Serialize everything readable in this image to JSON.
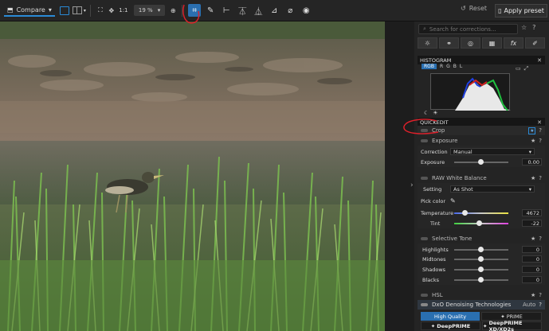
{
  "toolbar": {
    "compare_label": "Compare",
    "zoom_fit": "1:1",
    "zoom_value": "19 %",
    "reset_label": "Reset",
    "apply_preset_label": "Apply preset"
  },
  "panel": {
    "search_placeholder": "Search for corrections...",
    "histogram": {
      "title": "HISTOGRAM",
      "channels": [
        "RGB",
        "R",
        "G",
        "B",
        "L"
      ]
    },
    "quickedit": {
      "title": "QUICKEDIT",
      "crop_label": "Crop",
      "exposure": {
        "label": "Exposure",
        "correction_label": "Correction",
        "correction_value": "Manual",
        "exposure_label": "Exposure",
        "exposure_value": "0.00"
      },
      "raw_wb": {
        "label": "RAW White Balance",
        "setting_label": "Setting",
        "setting_value": "As Shot",
        "pick_color_label": "Pick color",
        "temperature_label": "Temperature",
        "temperature_value": "4672",
        "tint_label": "Tint",
        "tint_value": "-22"
      },
      "selective_tone": {
        "label": "Selective Tone",
        "highlights_label": "Highlights",
        "highlights_value": "0",
        "midtones_label": "Midtones",
        "midtones_value": "0",
        "shadows_label": "Shadows",
        "shadows_value": "0",
        "blacks_label": "Blacks",
        "blacks_value": "0"
      },
      "hsl_label": "HSL",
      "dxo": {
        "label": "DxO Denoising Technologies",
        "auto_label": "Auto",
        "high_quality_label": "High Quality",
        "prime_label": "PRIME",
        "deepprime_label": "DeepPRIME",
        "deepprime_xd_label": "DeepPRIME XD/XD2s"
      }
    }
  },
  "colors": {
    "accent": "#2a8ad6",
    "annotation": "#e0202a"
  }
}
